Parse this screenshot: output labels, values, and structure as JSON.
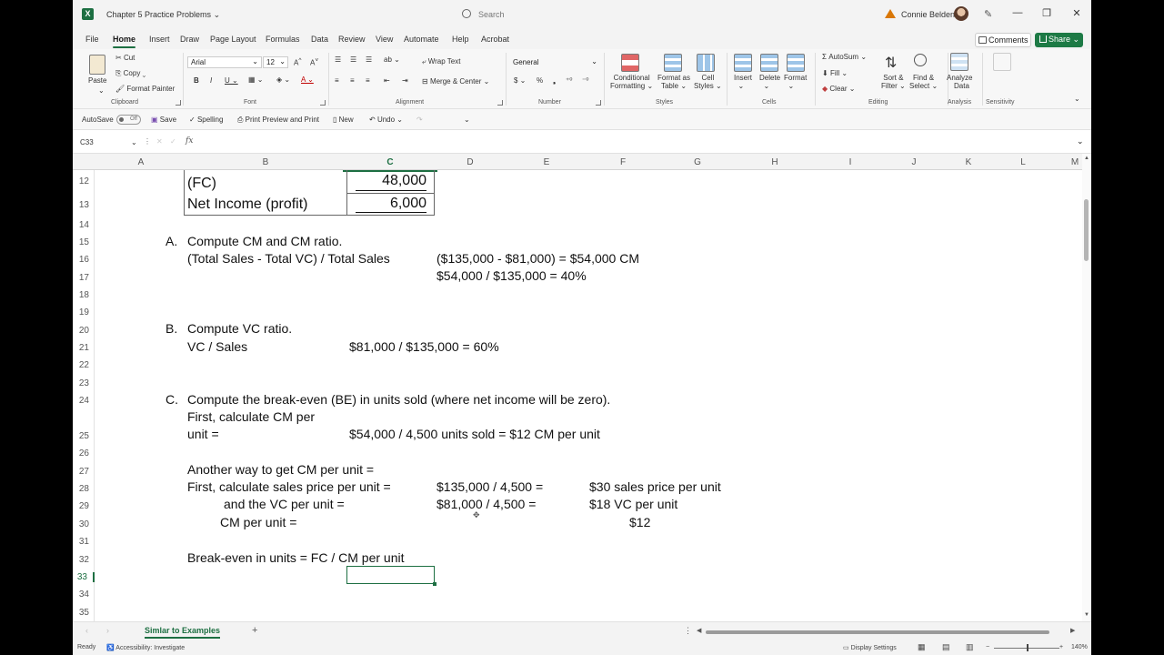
{
  "titlebar": {
    "document_name": "Chapter 5 Practice Problems",
    "search_placeholder": "Search",
    "user_name": "Connie Belden"
  },
  "menu_tabs": [
    "File",
    "Home",
    "Insert",
    "Draw",
    "Page Layout",
    "Formulas",
    "Data",
    "Review",
    "View",
    "Automate",
    "Help",
    "Acrobat"
  ],
  "active_tab": "Home",
  "comments_label": "Comments",
  "share_label": "Share",
  "ribbon": {
    "clipboard": {
      "paste": "Paste",
      "cut": "Cut",
      "copy": "Copy",
      "format_painter": "Format Painter",
      "group": "Clipboard"
    },
    "font": {
      "name": "Arial",
      "size": "12",
      "group": "Font"
    },
    "alignment": {
      "wrap_text": "Wrap Text",
      "merge_center": "Merge & Center",
      "group": "Alignment"
    },
    "number": {
      "format": "General",
      "group": "Number"
    },
    "styles": {
      "conditional": "Conditional",
      "conditional2": "Formatting",
      "format_as": "Format as",
      "format_as2": "Table",
      "cell": "Cell",
      "cell2": "Styles",
      "group": "Styles"
    },
    "cells": {
      "insert": "Insert",
      "delete": "Delete",
      "format": "Format",
      "group": "Cells"
    },
    "editing": {
      "autosum": "AutoSum",
      "fill": "Fill",
      "clear": "Clear",
      "sort": "Sort &",
      "sort2": "Filter",
      "find": "Find &",
      "find2": "Select",
      "group": "Editing"
    },
    "analysis": {
      "analyze": "Analyze",
      "analyze2": "Data",
      "group": "Analysis"
    },
    "sensitivity": {
      "group": "Sensitivity"
    }
  },
  "qat": {
    "autosave": "AutoSave",
    "autosave_state": "Off",
    "save": "Save",
    "spelling": "Spelling",
    "print_preview": "Print Preview and Print",
    "new": "New",
    "undo": "Undo"
  },
  "namebox": "C33",
  "columns": [
    "A",
    "B",
    "C",
    "D",
    "E",
    "F",
    "G",
    "H",
    "I",
    "J",
    "K",
    "L",
    "M"
  ],
  "selected_column": "C",
  "rows": [
    "12",
    "13",
    "14",
    "15",
    "16",
    "17",
    "18",
    "19",
    "20",
    "21",
    "22",
    "23",
    "24",
    "25",
    "26",
    "27",
    "28",
    "29",
    "30",
    "31",
    "32",
    "33",
    "34",
    "35"
  ],
  "selected_row": "33",
  "cells": {
    "b12": "(FC)",
    "c12": "48,000",
    "b13": "Net Income (profit)",
    "c13": "6,000",
    "a15": "A.",
    "b15": "Compute CM and CM ratio.",
    "b16": "(Total Sales - Total VC) / Total Sales",
    "d16": "($135,000 - $81,000) = $54,000 CM",
    "d17": "$54,000 / $135,000 = 40%",
    "a20": "B.",
    "b20": "Compute VC ratio.",
    "b21": "VC / Sales",
    "c21": "$81,000 / $135,000 = 60%",
    "a24": "C.",
    "b24": "Compute the break-even (BE)  in units sold (where net income will be zero).",
    "b24b": "First, calculate CM per",
    "b25": "unit =",
    "c25": "$54,000 / 4,500 units sold = $12 CM per unit",
    "b27": "Another way to get CM per unit =",
    "b28": "First, calculate sales price per unit =",
    "d28": "$135,000 / 4,500 =",
    "f28": "$30 sales price per unit",
    "b29": "and the VC per unit =",
    "d29": "$81,000 / 4,500 =",
    "f29": "$18 VC per unit",
    "b30": "CM per unit =",
    "f30": "$12",
    "b32": "Break-even in units = FC / CM per unit"
  },
  "sheet_tab": "Simlar to Examples",
  "status": {
    "ready": "Ready",
    "accessibility": "Accessibility: Investigate",
    "display_settings": "Display Settings",
    "zoom": "140%"
  }
}
